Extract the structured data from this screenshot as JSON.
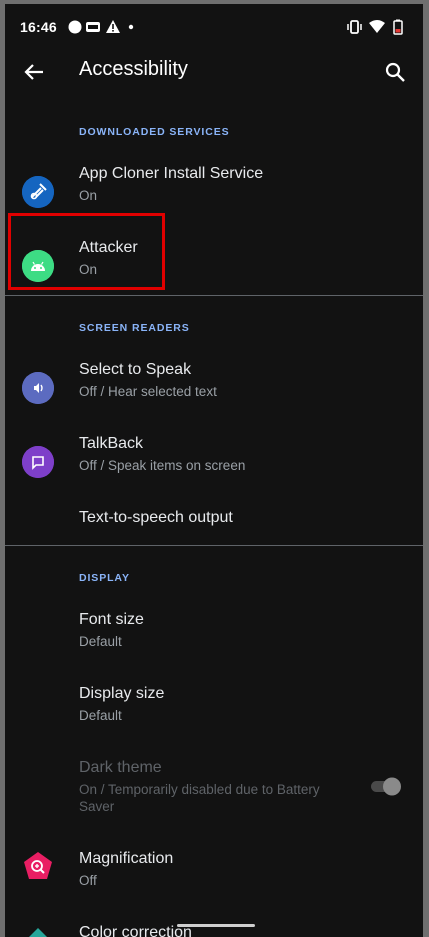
{
  "status_bar": {
    "time": "16:46",
    "left_icons": [
      "circle-notification-icon",
      "data-saver-icon",
      "warning-icon",
      "dot-icon"
    ],
    "right_icons": [
      "vibrate-icon",
      "wifi-icon",
      "battery-low-icon"
    ],
    "battery_color": "#e53935"
  },
  "toolbar": {
    "title": "Accessibility",
    "back_icon": "arrow-back-icon",
    "search_icon": "search-icon"
  },
  "sections": {
    "downloaded": {
      "header": "DOWNLOADED SERVICES",
      "items": [
        {
          "title": "App Cloner Install Service",
          "summary": "On",
          "icon": "app-cloner-icon",
          "icon_color": "#1565c0"
        },
        {
          "title": "Attacker",
          "summary": "On",
          "icon": "android-icon",
          "icon_color": "#3ddc84"
        }
      ]
    },
    "screen_readers": {
      "header": "SCREEN READERS",
      "items": [
        {
          "title": "Select to Speak",
          "summary": "Off / Hear selected text",
          "icon": "select-to-speak-icon",
          "icon_color": "#5c6bc0"
        },
        {
          "title": "TalkBack",
          "summary": "Off / Speak items on screen",
          "icon": "talkback-icon",
          "icon_color": "#7e3fc9"
        },
        {
          "title": "Text-to-speech output"
        }
      ]
    },
    "display": {
      "header": "DISPLAY",
      "items": [
        {
          "title": "Font size",
          "summary": "Default"
        },
        {
          "title": "Display size",
          "summary": "Default"
        },
        {
          "title": "Dark theme",
          "summary": "On / Temporarily disabled due to Battery Saver",
          "toggle_on": true,
          "disabled": true
        },
        {
          "title": "Magnification",
          "summary": "Off",
          "icon": "magnification-icon",
          "icon_color": "#e91e63"
        },
        {
          "title": "Color correction",
          "icon": "color-correction-icon",
          "icon_color": "#26a69a"
        }
      ]
    }
  },
  "highlight_color": "#e00000"
}
